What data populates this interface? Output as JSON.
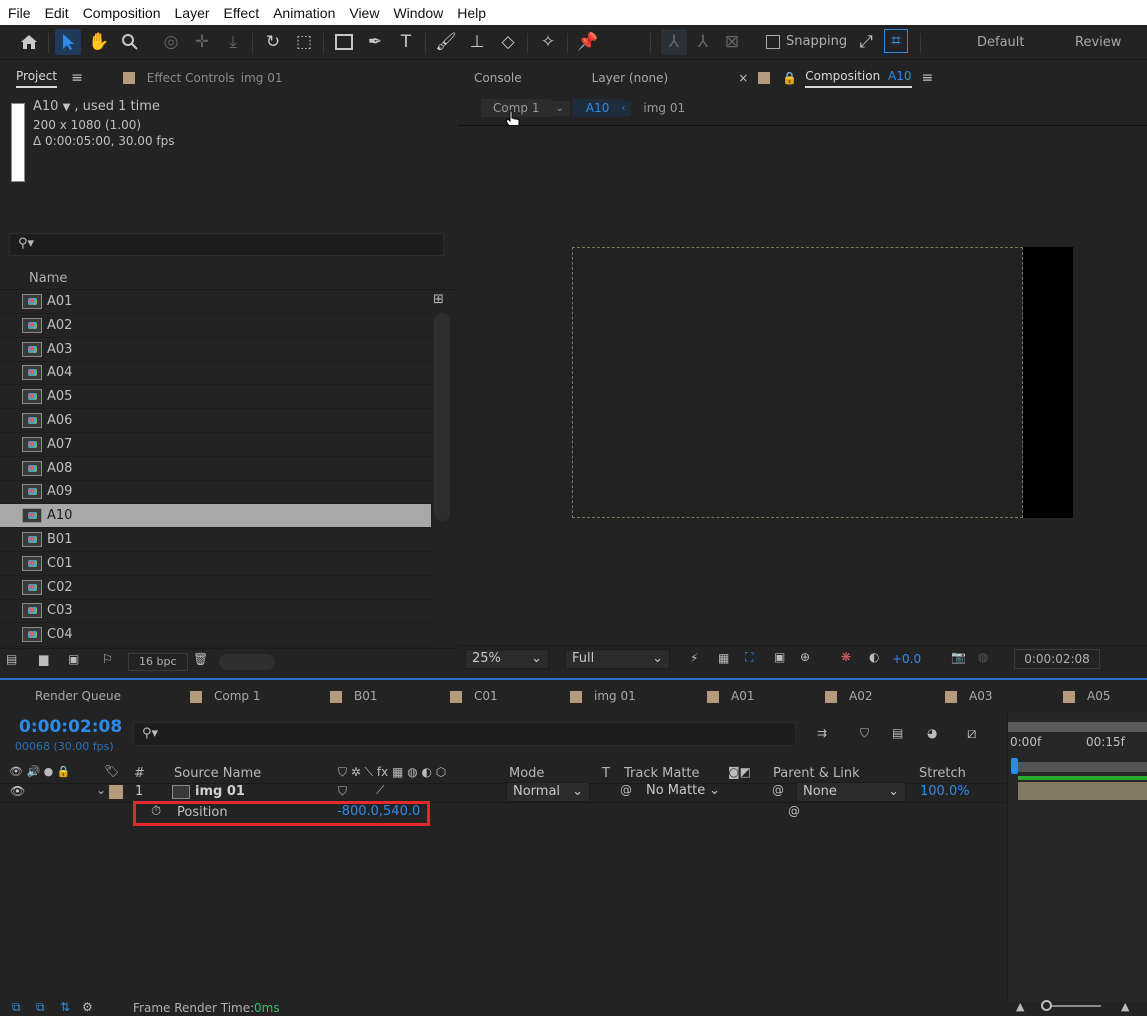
{
  "menu": [
    "File",
    "Edit",
    "Composition",
    "Layer",
    "Effect",
    "Animation",
    "View",
    "Window",
    "Help"
  ],
  "toolbar": {
    "snapping_label": "Snapping",
    "workspace_default": "Default",
    "workspace_review": "Review"
  },
  "project_panel": {
    "tab_project": "Project",
    "tab_effect_controls": "Effect Controls",
    "effect_controls_target": "img 01",
    "item_name": "A10",
    "item_usage": ", used 1 time",
    "item_dimensions": "200 x 1080 (1.00)",
    "item_duration": "Δ 0:00:05:00, 30.00 fps",
    "search_placeholder": "",
    "column_name": "Name",
    "items": [
      "A01",
      "A02",
      "A03",
      "A04",
      "A05",
      "A06",
      "A07",
      "A08",
      "A09",
      "A10",
      "B01",
      "C01",
      "C02",
      "C03",
      "C04"
    ],
    "selected_item": "A10",
    "bpc": "16 bpc"
  },
  "comp_panel": {
    "tab_console": "Console",
    "tab_layer": "Layer (none)",
    "tab_composition": "Composition",
    "composition_name": "A10",
    "breadcrumbs": [
      "Comp 1",
      "A10",
      "img 01"
    ],
    "zoom": "25%",
    "resolution": "Full",
    "exposure": "+0.0",
    "timecode": "0:00:02:08"
  },
  "timeline": {
    "tabs": [
      "Render Queue",
      "Comp 1",
      "B01",
      "C01",
      "img 01",
      "A01",
      "A02",
      "A03",
      "A05"
    ],
    "current_time": "0:00:02:08",
    "frame_info": "00068 (30.00 fps)",
    "columns": {
      "number": "#",
      "source_name": "Source Name",
      "mode": "Mode",
      "t": "T",
      "track_matte": "Track Matte",
      "parent_link": "Parent & Link",
      "stretch": "Stretch"
    },
    "layer": {
      "index": "1",
      "name": "img 01",
      "mode": "Normal",
      "track_matte": "No Matte",
      "parent": "None",
      "stretch": "100.0%"
    },
    "property": {
      "name": "Position",
      "value": "-800.0,540.0"
    },
    "ruler": [
      "0:00f",
      "00:15f"
    ],
    "footer_label": "Frame Render Time:",
    "footer_value": "0ms"
  }
}
